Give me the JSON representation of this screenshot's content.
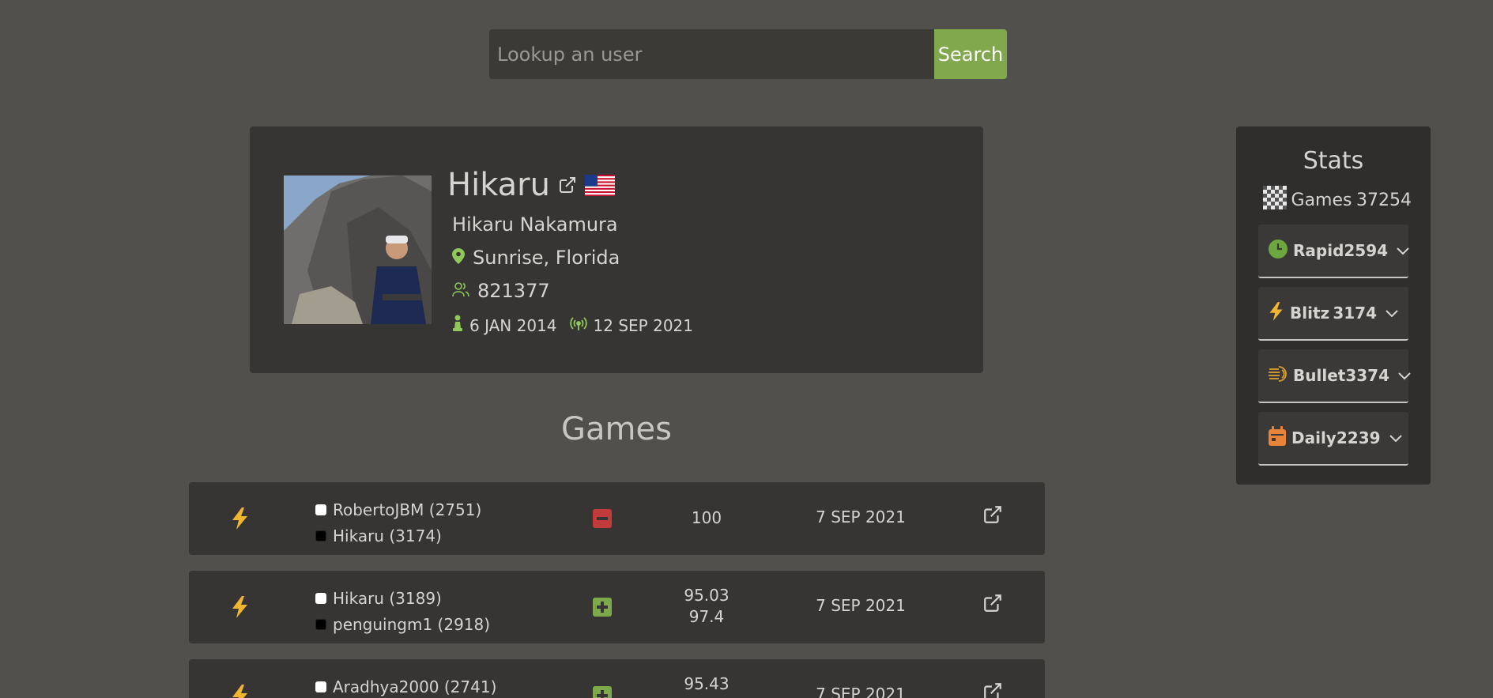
{
  "search": {
    "placeholder": "Lookup an user",
    "button_label": "Search"
  },
  "profile": {
    "username": "Hikaru",
    "real_name": "Hikaru Nakamura",
    "location": "Sunrise, Florida",
    "followers": "821377",
    "joined": "6 JAN 2014",
    "last_online": "12 SEP 2021",
    "flag_icon": "us-flag-icon"
  },
  "games_title": "Games",
  "games": [
    {
      "type_icon": "bolt-icon",
      "white": "RobertoJBM (2751)",
      "black": "Hikaru (3174)",
      "result": "loss",
      "accuracy": [
        "100"
      ],
      "date": "7 SEP 2021"
    },
    {
      "type_icon": "bolt-icon",
      "white": "Hikaru (3189)",
      "black": "penguingm1 (2918)",
      "result": "win",
      "accuracy": [
        "95.03",
        "97.4"
      ],
      "date": "7 SEP 2021"
    },
    {
      "type_icon": "bolt-icon",
      "white": "Aradhya2000 (2741)",
      "black": "",
      "result": "win",
      "accuracy": [
        "95.43"
      ],
      "date": "7 SEP 2021"
    }
  ],
  "stats": {
    "title": "Stats",
    "games_label": "Games",
    "games_count": "37254",
    "ratings": [
      {
        "name": "Rapid",
        "value": "2594",
        "icon": "clock-icon",
        "color": "#6ca83e"
      },
      {
        "name": "Blitz",
        "value": "3174",
        "icon": "bolt-icon",
        "color": "#f2b530"
      },
      {
        "name": "Bullet",
        "value": "3374",
        "icon": "bullet-icon",
        "color": "#d8a02c"
      },
      {
        "name": "Daily",
        "value": "2239",
        "icon": "calendar-icon",
        "color": "#e8833a"
      }
    ]
  },
  "colors": {
    "accent": "#81a84c",
    "background": "#52504c",
    "card": "#373533"
  }
}
